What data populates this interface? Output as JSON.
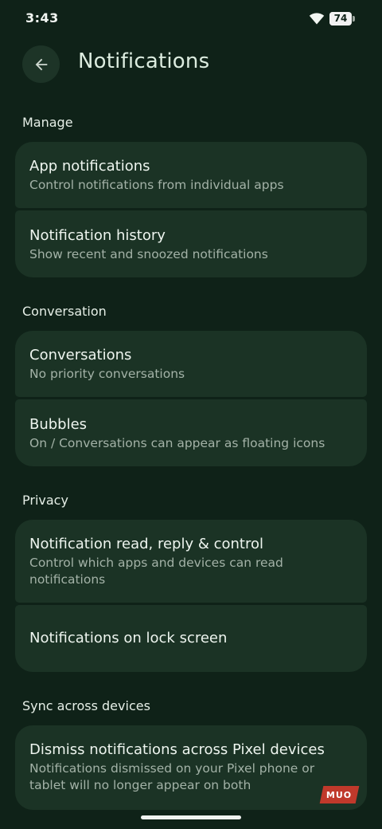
{
  "status_bar": {
    "time": "3:43",
    "battery_level": "74",
    "icons": [
      "wifi-icon",
      "battery-icon"
    ]
  },
  "header": {
    "back_icon": "arrow-left-icon",
    "title": "Notifications"
  },
  "sections": {
    "manage": {
      "label": "Manage",
      "items": [
        {
          "title": "App notifications",
          "subtitle": "Control notifications from individual apps"
        },
        {
          "title": "Notification history",
          "subtitle": "Show recent and snoozed notifications"
        }
      ]
    },
    "conversation": {
      "label": "Conversation",
      "items": [
        {
          "title": "Conversations",
          "subtitle": "No priority conversations"
        },
        {
          "title": "Bubbles",
          "subtitle": "On / Conversations can appear as floating icons"
        }
      ]
    },
    "privacy": {
      "label": "Privacy",
      "items": [
        {
          "title": "Notification read, reply & control",
          "subtitle": "Control which apps and devices can read notifications"
        },
        {
          "title": "Notifications on lock screen"
        }
      ]
    },
    "sync": {
      "label": "Sync across devices",
      "items": [
        {
          "title": "Dismiss notifications across Pixel devices",
          "subtitle": "Notifications dismissed on your Pixel phone or tablet will no longer appear on both"
        }
      ]
    }
  },
  "watermark": "MUO",
  "colors": {
    "background": "#0f2218",
    "card": "#1b3325",
    "title_text": "#dcecdf",
    "subtitle_text": "#a3b2a7"
  }
}
